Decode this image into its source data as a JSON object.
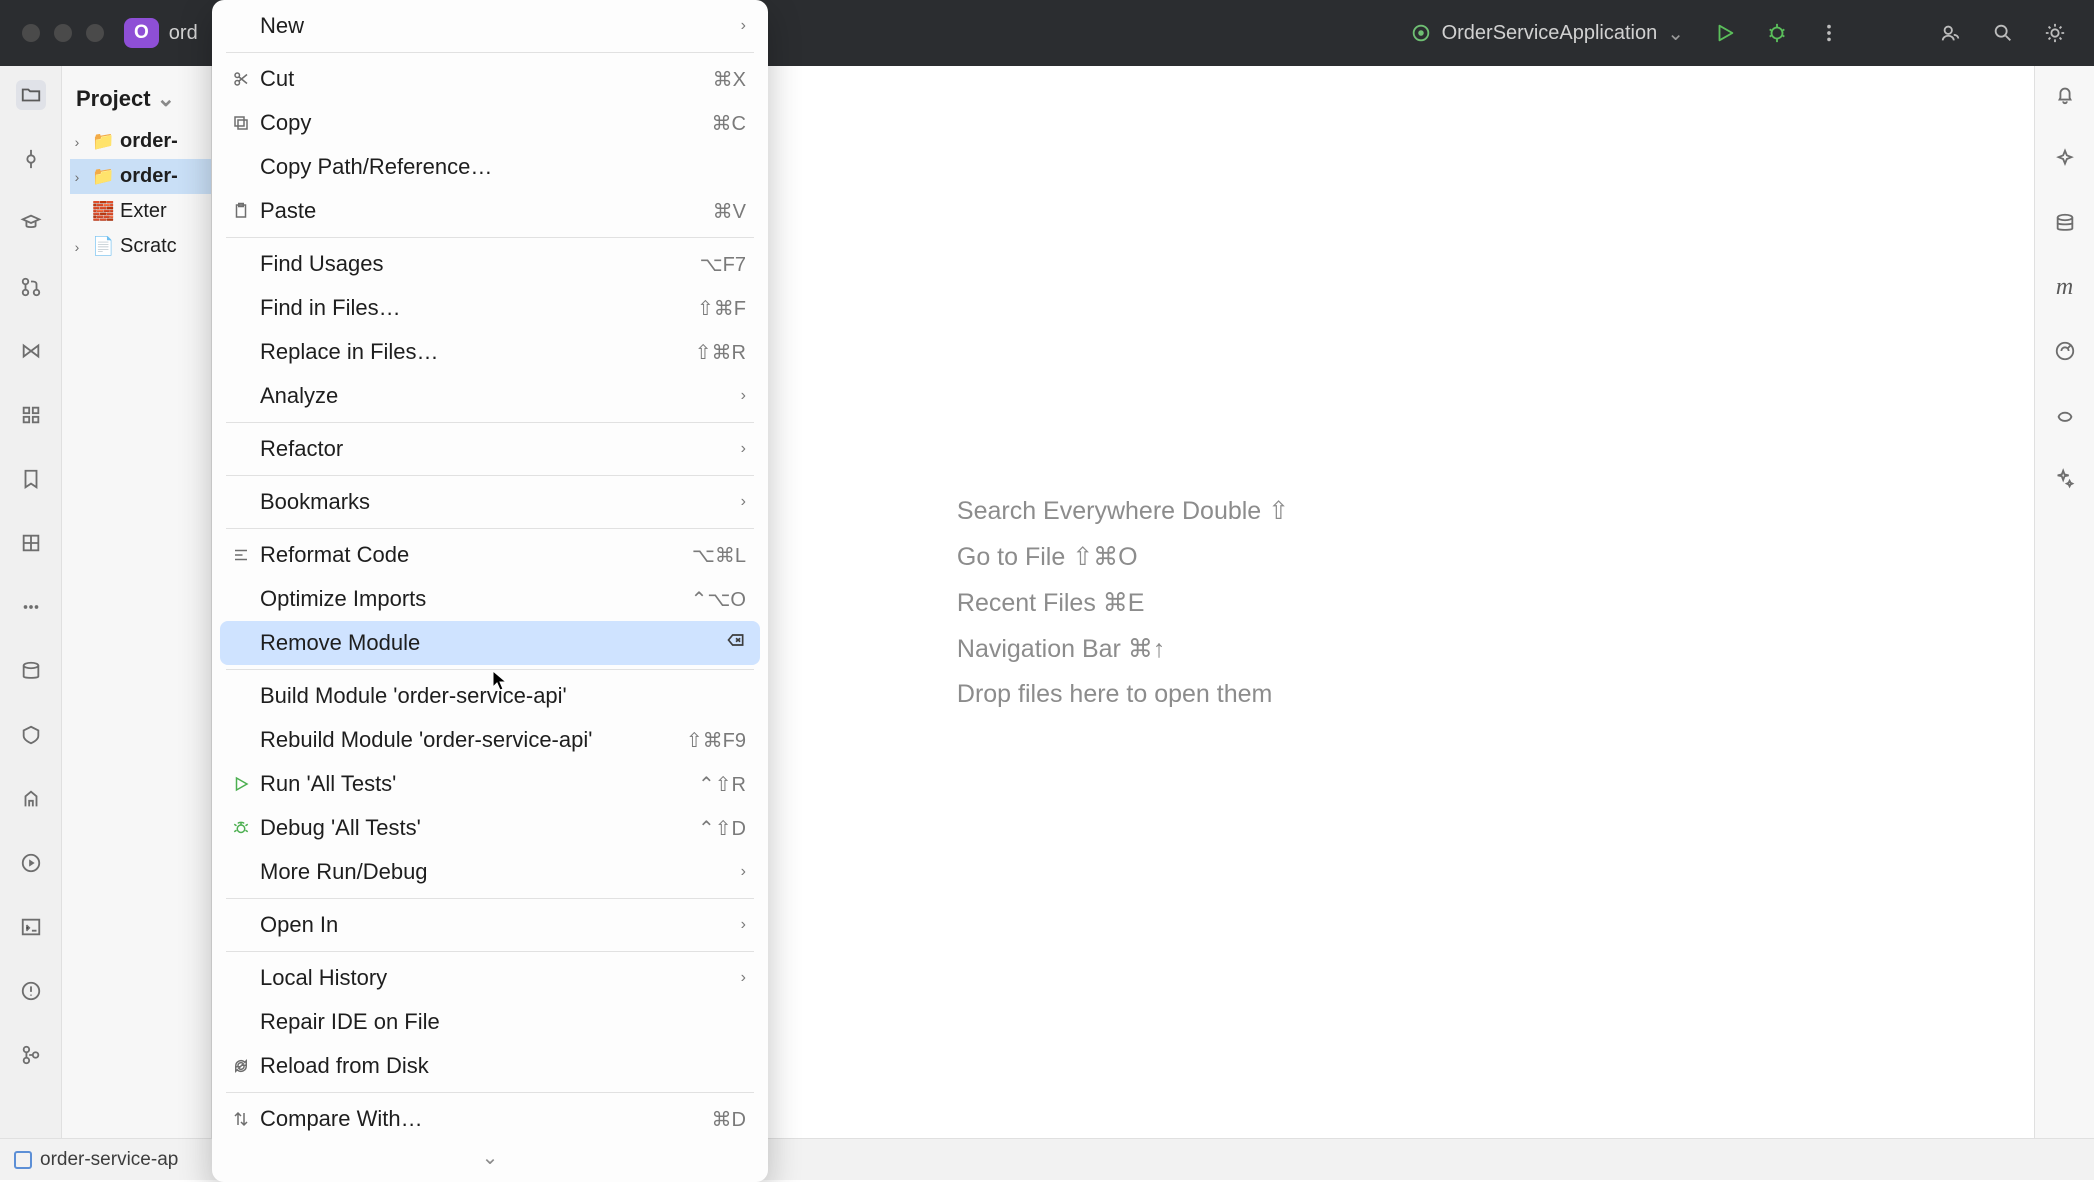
{
  "titlebar": {
    "project_name_partial": "ord",
    "badge": "O",
    "run_config": "OrderServiceApplication"
  },
  "left_panel": {
    "header": "Project",
    "tree": [
      {
        "label": "order-",
        "kind": "project",
        "expandable": true
      },
      {
        "label": "order-",
        "kind": "module",
        "expandable": true,
        "selected": true
      },
      {
        "label": "Exter",
        "kind": "lib",
        "expandable": false,
        "truncated": "External Libraries"
      },
      {
        "label": "Scratc",
        "kind": "scratch",
        "expandable": true,
        "truncated": "Scratches and Consoles"
      }
    ]
  },
  "context_menu": {
    "groups": [
      [
        {
          "label": "New",
          "submenu": true
        }
      ],
      [
        {
          "label": "Cut",
          "shortcut": "⌘X",
          "icon": "scissors-icon"
        },
        {
          "label": "Copy",
          "shortcut": "⌘C",
          "icon": "copy-icon"
        },
        {
          "label": "Copy Path/Reference…"
        },
        {
          "label": "Paste",
          "shortcut": "⌘V",
          "icon": "paste-icon"
        }
      ],
      [
        {
          "label": "Find Usages",
          "shortcut": "⌥F7"
        },
        {
          "label": "Find in Files…",
          "shortcut": "⇧⌘F"
        },
        {
          "label": "Replace in Files…",
          "shortcut": "⇧⌘R"
        },
        {
          "label": "Analyze",
          "submenu": true
        }
      ],
      [
        {
          "label": "Refactor",
          "submenu": true
        }
      ],
      [
        {
          "label": "Bookmarks",
          "submenu": true
        }
      ],
      [
        {
          "label": "Reformat Code",
          "shortcut": "⌥⌘L",
          "icon": "reformat-icon"
        },
        {
          "label": "Optimize Imports",
          "shortcut": "⌃⌥O"
        },
        {
          "label": "Remove Module",
          "icon": "backspace-icon",
          "highlight": true,
          "icon_right": true
        }
      ],
      [
        {
          "label": "Build Module 'order-service-api'"
        },
        {
          "label": "Rebuild Module 'order-service-api'",
          "shortcut": "⇧⌘F9"
        },
        {
          "label": "Run 'All Tests'",
          "shortcut": "⌃⇧R",
          "icon": "play-icon",
          "icon_color": "#4caf50"
        },
        {
          "label": "Debug 'All Tests'",
          "shortcut": "⌃⇧D",
          "icon": "bug-icon",
          "icon_color": "#4caf50"
        },
        {
          "label": "More Run/Debug",
          "submenu": true
        }
      ],
      [
        {
          "label": "Open In",
          "submenu": true
        }
      ],
      [
        {
          "label": "Local History",
          "submenu": true
        },
        {
          "label": "Repair IDE on File"
        },
        {
          "label": "Reload from Disk",
          "icon": "reload-icon"
        }
      ],
      [
        {
          "label": "Compare With…",
          "shortcut": "⌘D",
          "icon": "diff-icon"
        }
      ]
    ],
    "more_indicator": "⌄"
  },
  "editor_tips": [
    "Search Everywhere Double ⇧",
    "Go to File ⇧⌘O",
    "Recent Files ⌘E",
    "Navigation Bar ⌘↑",
    "Drop files here to open them"
  ],
  "statusbar": {
    "module": "order-service-ap"
  },
  "left_gutter_icons": [
    "folder-icon",
    "commit-icon",
    "learn-icon",
    "pull-request-icon",
    "gitlab-icon",
    "structure-icon",
    "bookmark-icon",
    "coverage-icon",
    "more-icon",
    "database-icon",
    "layers-icon",
    "build-icon",
    "run-window-icon",
    "terminal-icon",
    "problems-icon",
    "vcs-branch-icon"
  ],
  "right_gutter_icons": [
    "notifications-icon",
    "ai-spark-icon",
    "db-icon",
    "maven-icon",
    "endpoints-icon",
    "spring-icon",
    "ai-wand-icon"
  ]
}
